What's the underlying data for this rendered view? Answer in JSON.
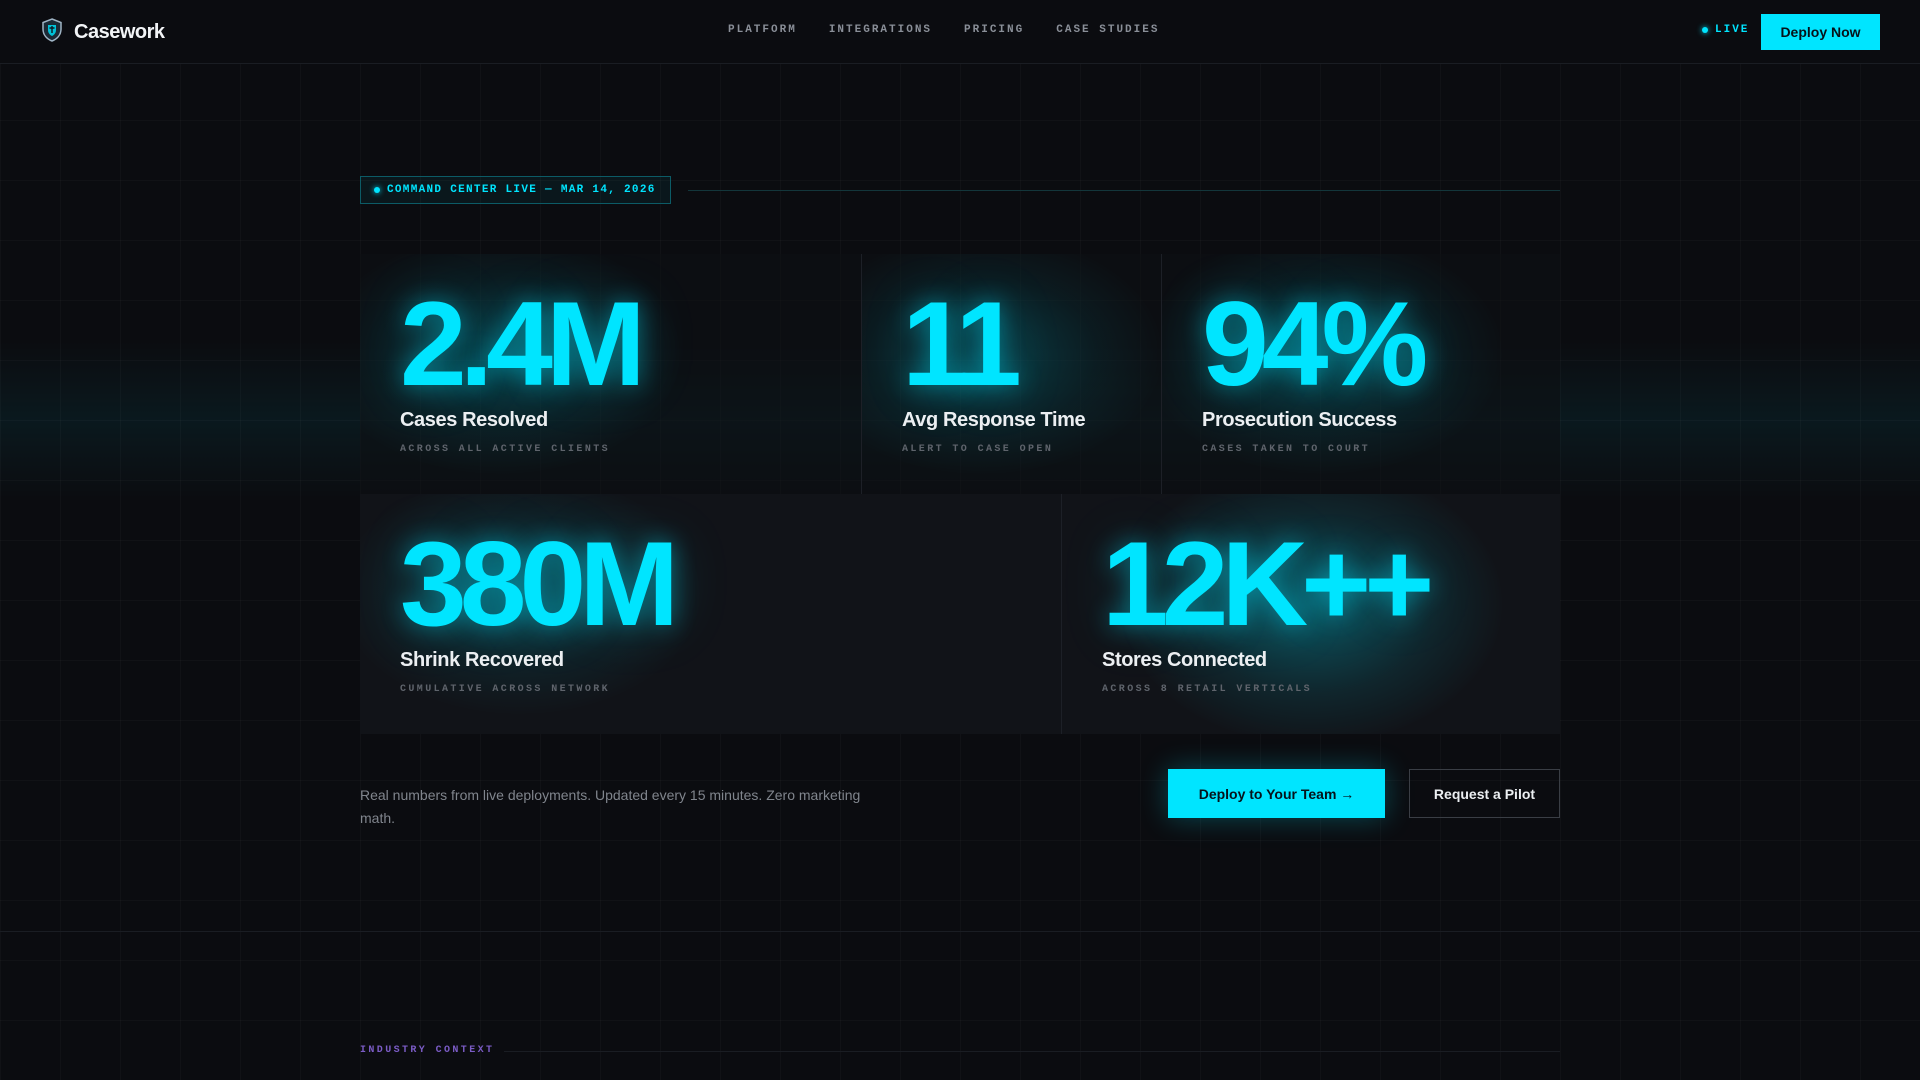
{
  "brand": {
    "name": "Casework",
    "icon": "shield-icon"
  },
  "nav": {
    "links": [
      "PLATFORM",
      "INTEGRATIONS",
      "PRICING",
      "CASE STUDIES"
    ],
    "live_label": "LIVE",
    "cta_label": "Deploy Now"
  },
  "badge": {
    "text": "COMMAND CENTER LIVE — MAR 14, 2026"
  },
  "stats": [
    {
      "value": "2.4M",
      "label": "Cases Resolved",
      "sub": "ACROSS ALL ACTIVE CLIENTS"
    },
    {
      "value": "11",
      "label": "Avg Response Time",
      "sub": "ALERT TO CASE OPEN"
    },
    {
      "value": "94%",
      "label": "Prosecution Success",
      "sub": "CASES TAKEN TO COURT"
    },
    {
      "value": "380M",
      "label": "Shrink Recovered",
      "sub": "CUMULATIVE ACROSS NETWORK"
    },
    {
      "value": "12K++",
      "label": "Stores Connected",
      "sub": "ACROSS 8 RETAIL VERTICALS"
    }
  ],
  "footer": {
    "note": "Real numbers from live deployments. Updated every 15 minutes. Zero marketing math.",
    "primary_cta": "Deploy to Your Team →",
    "secondary_cta": "Request a Pilot"
  },
  "next_section": {
    "eyebrow": "INDUSTRY CONTEXT"
  },
  "colors": {
    "accent": "#00e5ff",
    "background": "#0b0c10",
    "eyebrow": "#7b5cc6"
  }
}
